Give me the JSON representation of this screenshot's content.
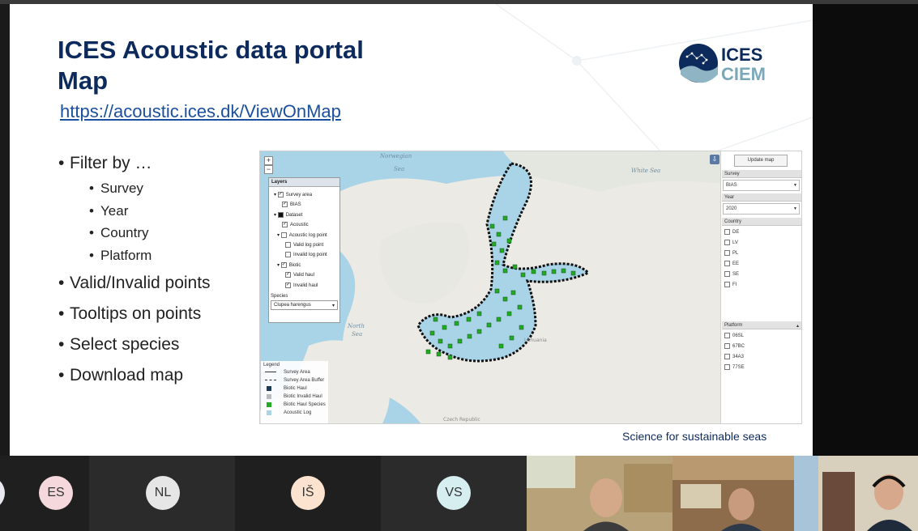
{
  "slide": {
    "title_line1": "ICES Acoustic data portal",
    "title_line2": "Map",
    "link": "https://acoustic.ices.dk/ViewOnMap",
    "logo_line1": "ICES",
    "logo_line2": "CIEM",
    "bullets": [
      {
        "text": "Filter by …",
        "sub": [
          "Survey",
          "Year",
          "Country",
          "Platform"
        ]
      },
      {
        "text": "Valid/Invalid points"
      },
      {
        "text": "Tooltips on points"
      },
      {
        "text": "Select species"
      },
      {
        "text": "Download map"
      }
    ],
    "footer": "Science for sustainable seas"
  },
  "map": {
    "zoom_in": "+",
    "zoom_out": "−",
    "place_labels": [
      "Norwegian",
      "Sea",
      "White Sea",
      "North",
      "Sea",
      "Lithuania",
      "Czech Republic"
    ],
    "layers": {
      "header": "Layers",
      "items": [
        {
          "label": "Survey area",
          "checked": true
        },
        {
          "label": "BIAS",
          "checked": true
        },
        {
          "label": "Dataset",
          "checked": true
        },
        {
          "label": "Acoustic",
          "checked": true
        },
        {
          "label": "Acoustic log point",
          "checked": false
        },
        {
          "label": "Valid log point",
          "checked": false
        },
        {
          "label": "Invalid log point",
          "checked": false
        },
        {
          "label": "Biotic",
          "checked": true
        },
        {
          "label": "Valid haul",
          "checked": true
        },
        {
          "label": "Invalid haul",
          "checked": true
        }
      ],
      "species_label": "Species",
      "species_value": "Clupea harengus"
    },
    "legend": {
      "title": "Legend",
      "items": [
        "Survey Area",
        "Survey Area Buffer",
        "Biotic Haul",
        "Biotic Invalid Haul",
        "Biotic Haul Species",
        "Acoustic Log"
      ],
      "colors": [
        "#ffffff",
        "#ffffff",
        "#1a3a5a",
        "#bbbbbb",
        "#22aa22",
        "#a9d3e6"
      ]
    }
  },
  "panel": {
    "update_button": "Update map",
    "survey_label": "Survey",
    "survey_value": "BIAS",
    "year_label": "Year",
    "year_value": "2020",
    "country_label": "Country",
    "countries": [
      "DE",
      "LV",
      "PL",
      "EE",
      "SE",
      "FI"
    ],
    "platform_label": "Platform",
    "platforms": [
      "06SL",
      "67BC",
      "34A3",
      "77SE"
    ]
  },
  "participants": [
    {
      "initials": "ES",
      "bg": "#f4d8dc"
    },
    {
      "initials": "NL",
      "bg": "#e6e6e6"
    },
    {
      "initials": "IŠ",
      "bg": "#fbe3cf"
    },
    {
      "initials": "VS",
      "bg": "#d6eef0"
    }
  ]
}
